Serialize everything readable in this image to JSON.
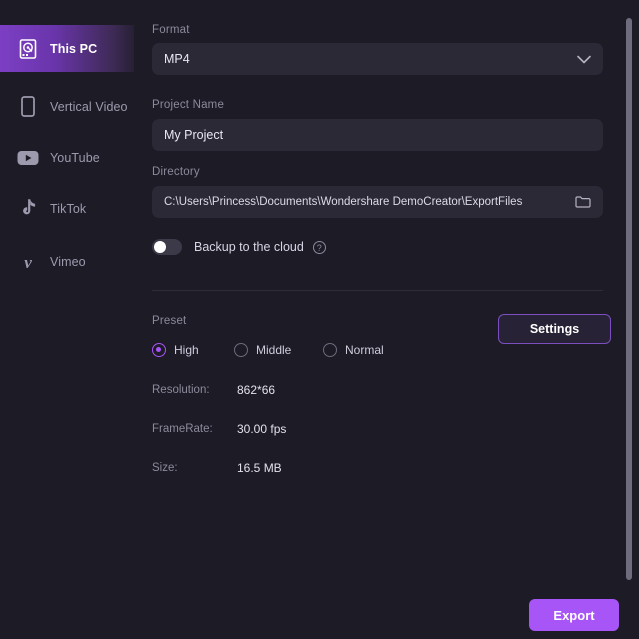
{
  "colors": {
    "background": "#1d1b26",
    "panel_input": "#2b2936",
    "accent": "#a855f7",
    "accent_dark": "#7c3fc4",
    "text_primary": "#e6e4ef",
    "text_muted": "#8d8a9c",
    "divider": "#2e2c3a"
  },
  "sidebar": {
    "items": [
      {
        "label": "This PC",
        "icon": "hard-drive-icon",
        "active": true
      },
      {
        "label": "Vertical Video",
        "icon": "phone-icon",
        "active": false
      },
      {
        "label": "YouTube",
        "icon": "youtube-icon",
        "active": false
      },
      {
        "label": "TikTok",
        "icon": "tiktok-icon",
        "active": false
      },
      {
        "label": "Vimeo",
        "icon": "vimeo-icon",
        "active": false
      }
    ]
  },
  "main": {
    "format": {
      "label": "Format",
      "value": "MP4",
      "dropdown_icon": "chevron-down-icon"
    },
    "project_name": {
      "label": "Project Name",
      "value": "My Project",
      "placeholder": "Project Name"
    },
    "directory": {
      "label": "Directory",
      "value": "C:\\Users\\Princess\\Documents\\Wondershare DemoCreator\\ExportFiles",
      "browse_icon": "folder-icon"
    },
    "backup": {
      "label": "Backup to the cloud",
      "enabled": false,
      "help_icon": "question-mark-icon",
      "help_glyph": "?"
    },
    "preset": {
      "label": "Preset",
      "selected": "High",
      "options": [
        {
          "label": "High",
          "selected": true
        },
        {
          "label": "Middle",
          "selected": false
        },
        {
          "label": "Normal",
          "selected": false
        }
      ],
      "settings_button": "Settings"
    },
    "info": [
      {
        "key": "Resolution:",
        "value": "862*66"
      },
      {
        "key": "FrameRate:",
        "value": "30.00 fps"
      },
      {
        "key": "Size:",
        "value": "16.5 MB"
      }
    ],
    "export_button": "Export"
  }
}
